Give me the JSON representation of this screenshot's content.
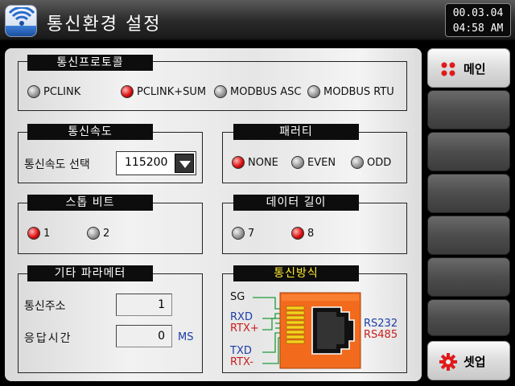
{
  "header": {
    "title": "통신환경 설정",
    "date": "00.03.04",
    "time": "04:58 AM"
  },
  "protocol": {
    "title": "통신프로토콜",
    "options": [
      {
        "label": "PCLINK",
        "selected": false
      },
      {
        "label": "PCLINK+SUM",
        "selected": true
      },
      {
        "label": "MODBUS ASC",
        "selected": false
      },
      {
        "label": "MODBUS RTU",
        "selected": false
      }
    ]
  },
  "speed": {
    "title": "통신속도",
    "label": "통신속도 선택",
    "value": "115200"
  },
  "parity": {
    "title": "패러티",
    "options": [
      {
        "label": "NONE",
        "selected": true
      },
      {
        "label": "EVEN",
        "selected": false
      },
      {
        "label": "ODD",
        "selected": false
      }
    ]
  },
  "stop_bit": {
    "title": "스톱 비트",
    "options": [
      {
        "label": "1",
        "selected": true
      },
      {
        "label": "2",
        "selected": false
      }
    ]
  },
  "data_length": {
    "title": "데이터 길이",
    "options": [
      {
        "label": "7",
        "selected": false
      },
      {
        "label": "8",
        "selected": true
      }
    ]
  },
  "other_params": {
    "title": "기타 파라메터",
    "address_label": "통신주소",
    "address_value": "1",
    "response_label": "응답시간",
    "response_value": "0",
    "response_unit": "MS"
  },
  "comm_method": {
    "title": "통신방식",
    "sg": "SG",
    "rxd": "RXD",
    "rtx_plus": "RTX+",
    "txd": "TXD",
    "rtx_minus": "RTX-",
    "rs232": "RS232",
    "rs485": "RS485"
  },
  "sidebar": {
    "main_label": "메인",
    "setup_label": "셋업"
  },
  "colors": {
    "selected": "#d11111",
    "unselected": "#999999",
    "accent_orange": "#f26b1d",
    "blue_text": "#1a3ea8",
    "red_text": "#c81e1e"
  }
}
